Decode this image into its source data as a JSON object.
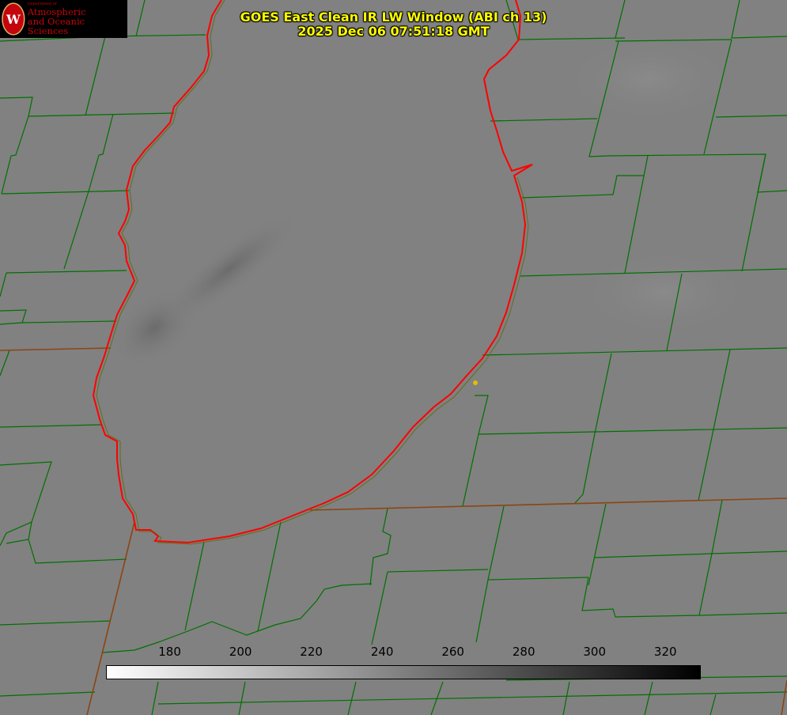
{
  "header": {
    "title_line1": "GOES East Clean IR LW Window (ABI ch 13)",
    "title_line2": "2025 Dec 06 07:51:18 GMT"
  },
  "logo": {
    "dept": "Department of",
    "line1": "Atmospheric",
    "line2": "and Oceanic Sciences",
    "seal_letter": "W"
  },
  "colorbar": {
    "ticks": [
      "180",
      "200",
      "220",
      "240",
      "260",
      "280",
      "300",
      "320"
    ],
    "range": [
      162,
      330
    ],
    "gradient": [
      "#ffffff",
      "#000000"
    ]
  },
  "colors": {
    "county_lines": "#007000",
    "coastline": "#ff0000",
    "state_lines": "#8b4513",
    "title": "#ffff00",
    "marker": "#e0c000"
  }
}
